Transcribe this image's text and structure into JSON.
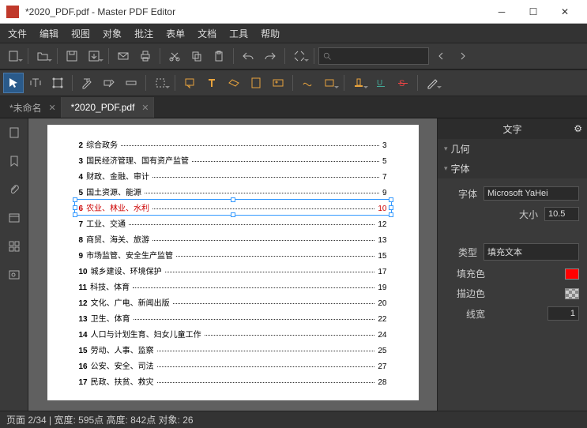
{
  "window": {
    "title": "*2020_PDF.pdf - Master PDF Editor"
  },
  "menu": {
    "file": "文件",
    "edit": "编辑",
    "view": "视图",
    "object": "对象",
    "annotate": "批注",
    "form": "表单",
    "document": "文档",
    "tools": "工具",
    "help": "帮助"
  },
  "tabs": {
    "t1": "*未命名",
    "t2": "*2020_PDF.pdf"
  },
  "toc": [
    {
      "n": "2",
      "t": "综合政务",
      "p": "3"
    },
    {
      "n": "3",
      "t": "国民经济管理、国有资产监管",
      "p": "5"
    },
    {
      "n": "4",
      "t": "财政、金融、审计",
      "p": "7"
    },
    {
      "n": "5",
      "t": "国土资源、能源",
      "p": "9"
    },
    {
      "n": "6",
      "t": "农业、林业、水利",
      "p": "10"
    },
    {
      "n": "7",
      "t": "工业、交通",
      "p": "12"
    },
    {
      "n": "8",
      "t": "商贸、海关、旅游",
      "p": "13"
    },
    {
      "n": "9",
      "t": "市场监管、安全生产监管",
      "p": "15"
    },
    {
      "n": "10",
      "t": "城乡建设、环境保护",
      "p": "17"
    },
    {
      "n": "11",
      "t": "科技、体育",
      "p": "19"
    },
    {
      "n": "12",
      "t": "文化、广电、新闻出版",
      "p": "20"
    },
    {
      "n": "13",
      "t": "卫生、体育",
      "p": "22"
    },
    {
      "n": "14",
      "t": "人口与计划生育、妇女儿童工作",
      "p": "24"
    },
    {
      "n": "15",
      "t": "劳动、人事、监察",
      "p": "25"
    },
    {
      "n": "16",
      "t": "公安、安全、司法",
      "p": "27"
    },
    {
      "n": "17",
      "t": "民政、扶贫、救灾",
      "p": "28"
    }
  ],
  "selected_index": 4,
  "panel": {
    "title": "文字",
    "geometry": "几何",
    "font_section": "字体",
    "font_label": "字体",
    "font_value": "Microsoft YaHei",
    "size_label": "大小",
    "size_value": "10.5",
    "type_label": "类型",
    "type_value": "填充文本",
    "fill_label": "填充色",
    "fill_color": "#ff0000",
    "stroke_label": "描边色",
    "stroke_color": "transparent",
    "linewidth_label": "线宽",
    "linewidth_value": "1"
  },
  "status": {
    "text": "页面 2/34 | 宽度: 595点 高度: 842点 对象: 26"
  }
}
